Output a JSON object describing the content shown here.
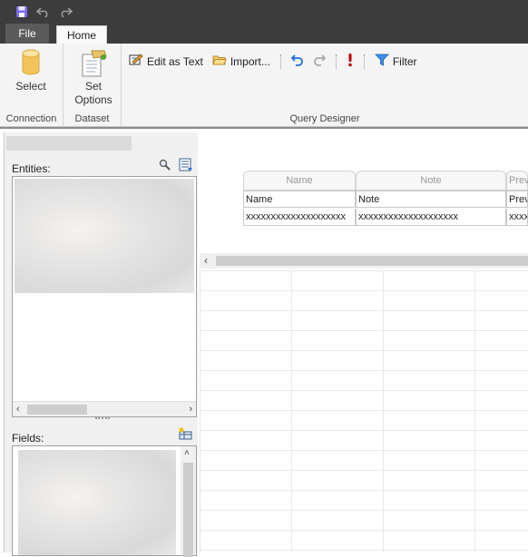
{
  "quick_access": {
    "items": [
      {
        "name": "save-icon",
        "color": "#6a5acd"
      },
      {
        "name": "undo-icon",
        "color": "#aaaaaa"
      },
      {
        "name": "redo-icon",
        "color": "#aaaaaa"
      }
    ]
  },
  "tabs": {
    "file": "File",
    "home": "Home"
  },
  "ribbon": {
    "connection": {
      "select_label": "Select",
      "group_label": "Connection"
    },
    "dataset": {
      "set_options_line1": "Set",
      "set_options_line2": "Options",
      "group_label": "Dataset"
    },
    "query_designer": {
      "edit_as_text": "Edit as Text",
      "import": "Import...",
      "filter": "Filter",
      "group_label": "Query Designer"
    }
  },
  "left_panel": {
    "entities_label": "Entities:",
    "fields_label": "Fields:"
  },
  "query_grid": {
    "header_top": [
      "Name",
      "Note",
      "Prev"
    ],
    "header": [
      "Name",
      "Note",
      "Prev"
    ],
    "rows": [
      [
        "xxxxxxxxxxxxxxxxxxxx",
        "xxxxxxxxxxxxxxxxxxxx",
        "xxxx"
      ]
    ]
  },
  "colors": {
    "title_bar": "#3c3c3c",
    "ribbon_bg": "#f4f4f4",
    "accent_blue": "#1e6fd9",
    "exclamation_red": "#c00000"
  }
}
